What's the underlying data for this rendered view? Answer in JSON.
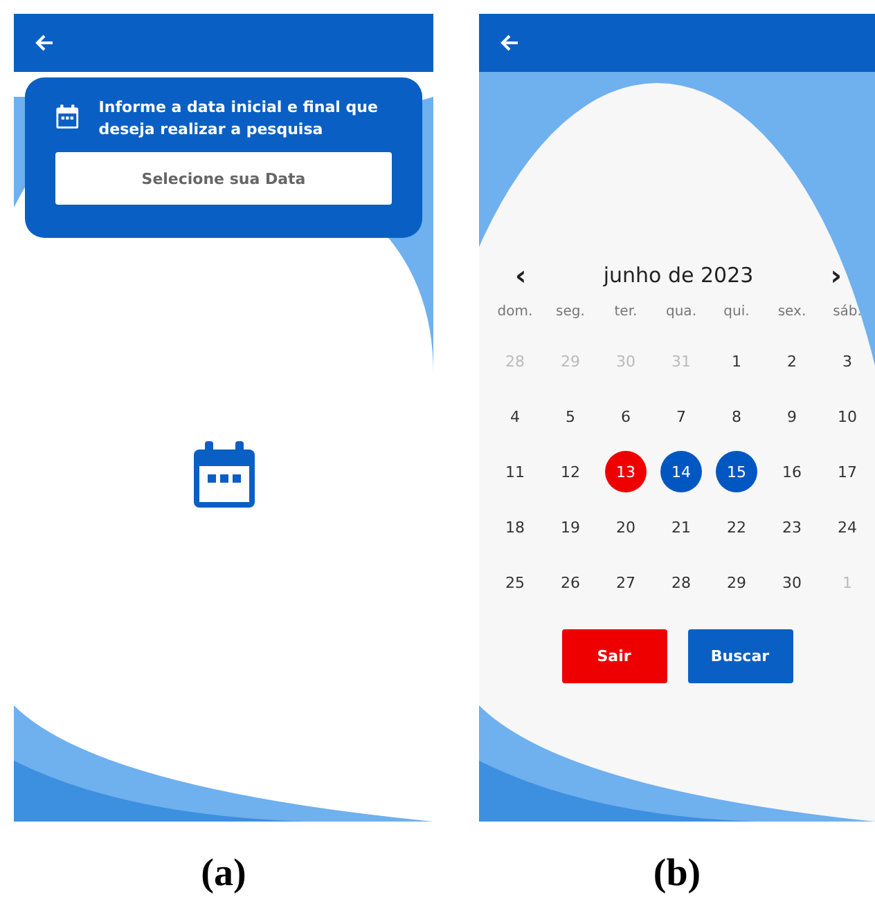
{
  "screens": [
    {
      "kind": "search",
      "caption": "(a)",
      "card": {
        "message": "Informe a data inicial e final que deseja realizar a pesquisa",
        "button": "Selecione sua Data"
      }
    },
    {
      "kind": "calendar",
      "caption": "(b)",
      "month": "junho de 2023",
      "prev": "‹",
      "next": "›",
      "weekdays": [
        "dom.",
        "seg.",
        "ter.",
        "qua.",
        "qui.",
        "sex.",
        "sáb."
      ],
      "days": [
        {
          "label": "28",
          "muted": true,
          "selected": false
        },
        {
          "label": "29",
          "muted": true,
          "selected": false
        },
        {
          "label": "30",
          "muted": true,
          "selected": false
        },
        {
          "label": "31",
          "muted": true,
          "selected": false
        },
        {
          "label": "1",
          "muted": false,
          "selected": false
        },
        {
          "label": "2",
          "muted": false,
          "selected": false
        },
        {
          "label": "3",
          "muted": false,
          "selected": false
        },
        {
          "label": "4",
          "muted": false,
          "selected": false
        },
        {
          "label": "5",
          "muted": false,
          "selected": false
        },
        {
          "label": "6",
          "muted": false,
          "selected": false
        },
        {
          "label": "7",
          "muted": false,
          "selected": false
        },
        {
          "label": "8",
          "muted": false,
          "selected": false
        },
        {
          "label": "9",
          "muted": false,
          "selected": false
        },
        {
          "label": "10",
          "muted": false,
          "selected": false
        },
        {
          "label": "11",
          "muted": false,
          "selected": false
        },
        {
          "label": "12",
          "muted": false,
          "selected": false
        },
        {
          "label": "13",
          "muted": false,
          "selected": true,
          "color": "#ee0000"
        },
        {
          "label": "14",
          "muted": false,
          "selected": true,
          "color": "#0057c2"
        },
        {
          "label": "15",
          "muted": false,
          "selected": true,
          "color": "#0057c2"
        },
        {
          "label": "16",
          "muted": false,
          "selected": false
        },
        {
          "label": "17",
          "muted": false,
          "selected": false
        },
        {
          "label": "18",
          "muted": false,
          "selected": false
        },
        {
          "label": "19",
          "muted": false,
          "selected": false
        },
        {
          "label": "20",
          "muted": false,
          "selected": false
        },
        {
          "label": "21",
          "muted": false,
          "selected": false
        },
        {
          "label": "22",
          "muted": false,
          "selected": false
        },
        {
          "label": "23",
          "muted": false,
          "selected": false
        },
        {
          "label": "24",
          "muted": false,
          "selected": false
        },
        {
          "label": "25",
          "muted": false,
          "selected": false
        },
        {
          "label": "26",
          "muted": false,
          "selected": false
        },
        {
          "label": "27",
          "muted": false,
          "selected": false
        },
        {
          "label": "28",
          "muted": false,
          "selected": false
        },
        {
          "label": "29",
          "muted": false,
          "selected": false
        },
        {
          "label": "30",
          "muted": false,
          "selected": false
        },
        {
          "label": "1",
          "muted": true,
          "selected": false
        }
      ],
      "buttons": [
        {
          "label": "Sair",
          "kind": "cancel"
        },
        {
          "label": "Buscar",
          "kind": "confirm"
        }
      ]
    }
  ]
}
